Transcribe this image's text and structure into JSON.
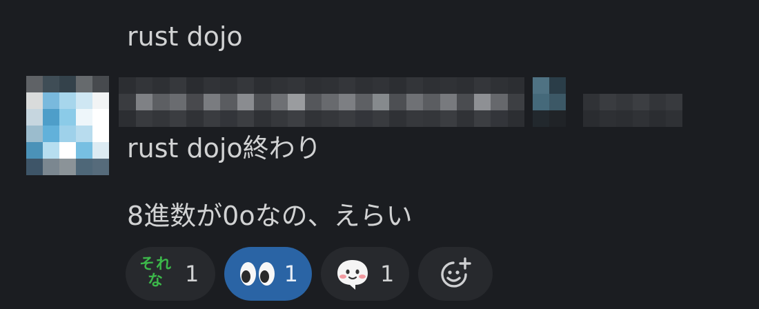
{
  "thread": {
    "previous_message": "rust dojo",
    "message": {
      "lines": [
        "rust dojo終わり",
        "8進数が0oなの、えらい"
      ],
      "sender_name_redacted": true,
      "timestamp_redacted": true
    },
    "reactions": [
      {
        "emoji": "sorena-emoji",
        "emoji_text": [
          "そ",
          "れ",
          "な"
        ],
        "count": "1",
        "active": false
      },
      {
        "emoji": "eyes-emoji",
        "count": "1",
        "active": true
      },
      {
        "emoji": "blush-face-emoji",
        "count": "1",
        "active": false
      }
    ],
    "add_reaction": {
      "icon": "add-reaction-icon"
    }
  },
  "colors": {
    "background": "#1b1d21",
    "text": "#d1d2d3",
    "reaction_bg": "#27292d",
    "reaction_active_bg": "#2a64a5",
    "sorena_green": "#3cb84a"
  }
}
